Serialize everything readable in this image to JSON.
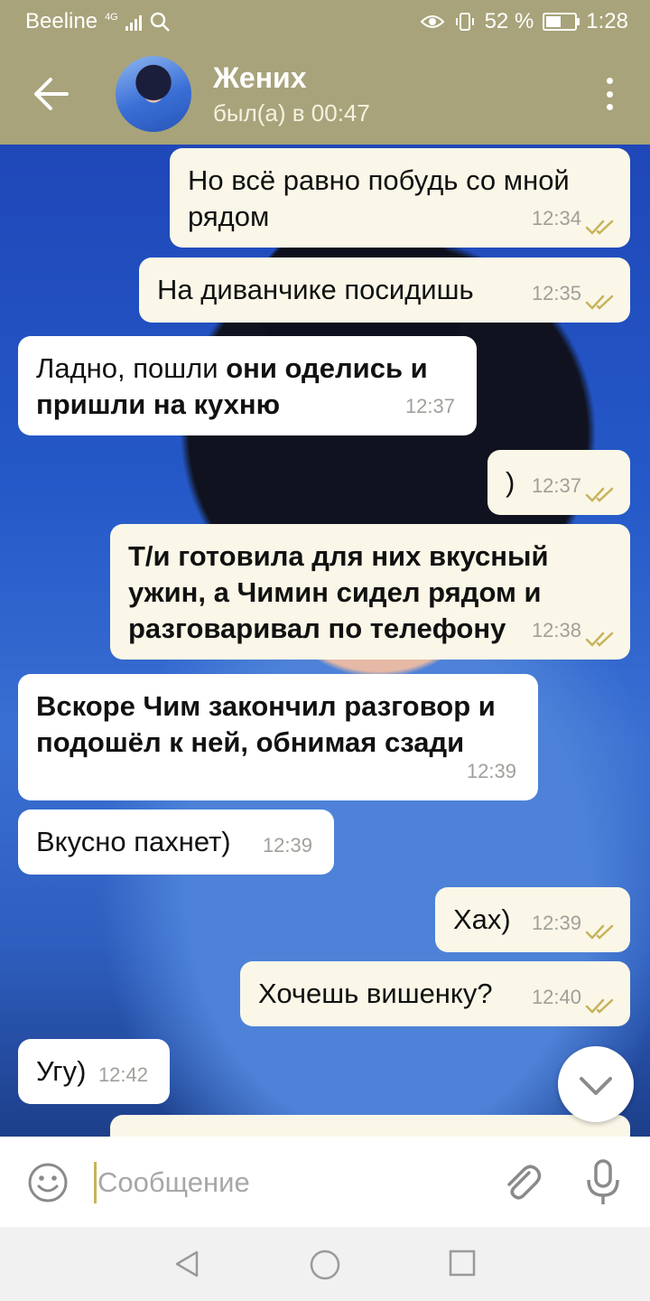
{
  "status_bar": {
    "carrier": "Beeline",
    "network": "4G",
    "battery_percent": "52 %",
    "time": "1:28"
  },
  "header": {
    "title": "Жених",
    "subtitle": "был(а) в 00:47"
  },
  "messages": [
    {
      "dir": "out",
      "text": "Но всё равно побудь со мной рядом",
      "time": "12:34",
      "read": true
    },
    {
      "dir": "out",
      "text": "На диванчике посидишь",
      "time": "12:35",
      "read": true
    },
    {
      "dir": "in",
      "text_plain": "Ладно, пошли ",
      "text_bold": "они оделись и пришли на кухню",
      "time": "12:37"
    },
    {
      "dir": "out",
      "text": ")",
      "time": "12:37",
      "read": true
    },
    {
      "dir": "out",
      "text_bold": "Т/и готовила для них вкусный ужин, а Чимин сидел рядом и разговаривал по телефону",
      "time": "12:38",
      "read": true
    },
    {
      "dir": "in",
      "text_bold": "Вскоре Чим закончил разговор и подошёл к ней, обнимая сзади",
      "time": "12:39"
    },
    {
      "dir": "in",
      "text": "Вкусно пахнет)",
      "time": "12:39"
    },
    {
      "dir": "out",
      "text": "Хах)",
      "time": "12:39",
      "read": true
    },
    {
      "dir": "out",
      "text": "Хочешь вишенку?",
      "time": "12:40",
      "read": true
    },
    {
      "dir": "in",
      "text": "Угу)",
      "time": "12:42"
    }
  ],
  "composer": {
    "placeholder": "Сообщение"
  },
  "icons": {
    "back": "arrow-left-icon",
    "menu": "more-vertical-icon",
    "scroll_down": "chevron-down-icon",
    "emoji": "smiley-icon",
    "attach": "paperclip-icon",
    "mic": "microphone-icon"
  },
  "colors": {
    "header": "#a8a37a",
    "outgoing_bubble": "#faf7e8",
    "incoming_bubble": "#ffffff",
    "ticks": "#c7b35a"
  }
}
